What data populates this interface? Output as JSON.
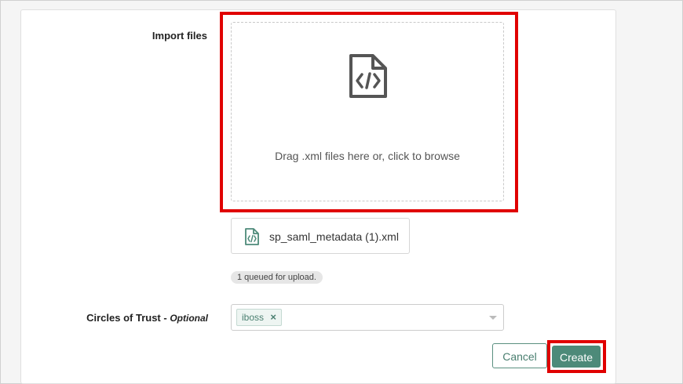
{
  "form": {
    "import_label": "Import files",
    "dropzone_hint": "Drag .xml files here or, click to browse",
    "file_icon": "xml-code-file-icon",
    "queued_files": [
      {
        "name": "sp_saml_metadata (1).xml",
        "icon": "xml-code-file-icon"
      }
    ],
    "queued_status": "1 queued for upload.",
    "circles_label": "Circles of Trust -",
    "circles_optional": "Optional",
    "selected_tags": [
      {
        "label": "iboss",
        "remove_glyph": "×"
      }
    ]
  },
  "actions": {
    "cancel_label": "Cancel",
    "create_label": "Create"
  },
  "colors": {
    "accent": "#4d8a79",
    "highlight": "#e00000",
    "tag_text": "#4a7f70"
  }
}
